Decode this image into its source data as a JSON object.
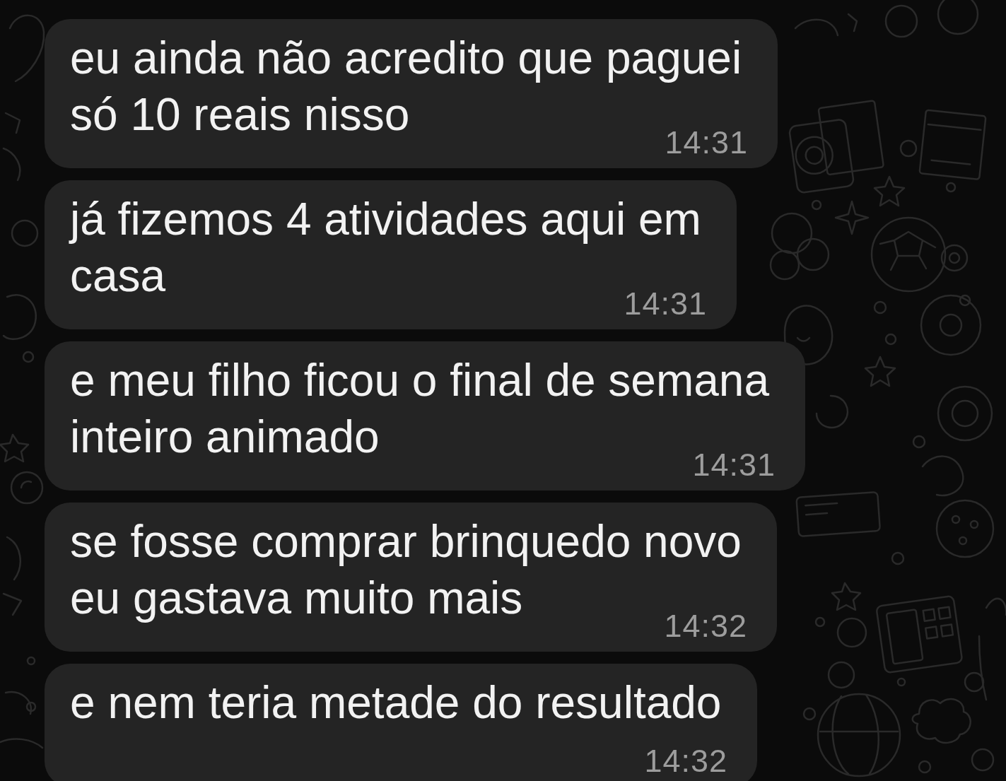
{
  "messages": [
    {
      "text": "eu ainda não acredito que paguei só 10 reais nisso",
      "time": "14:31"
    },
    {
      "text": "já fizemos 4 atividades aqui em casa",
      "time": "14:31"
    },
    {
      "text": "e meu filho ficou o final de semana inteiro animado",
      "time": "14:31"
    },
    {
      "text": "se fosse comprar brinquedo novo eu gastava muito mais",
      "time": "14:32"
    },
    {
      "text": "e nem teria metade do resultado",
      "time": "14:32"
    }
  ]
}
